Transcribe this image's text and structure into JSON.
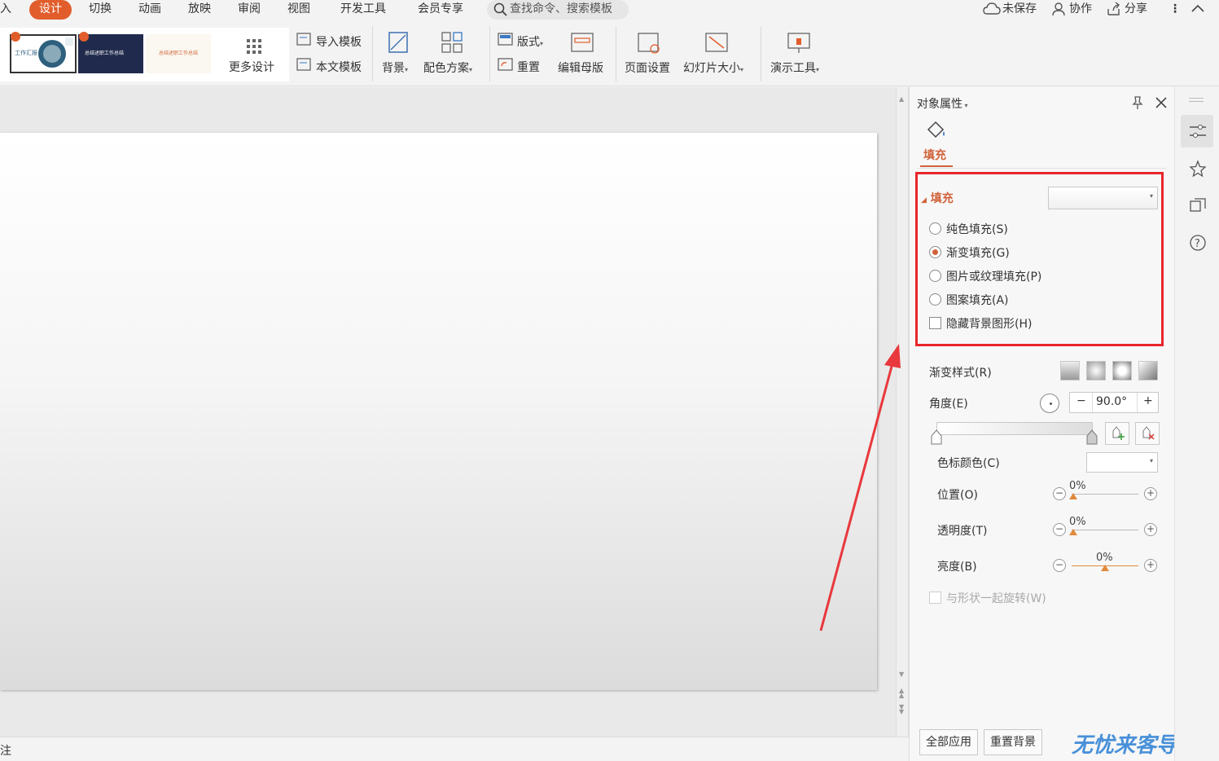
{
  "menu": {
    "partial_first": "入",
    "items": [
      "设计",
      "切换",
      "动画",
      "放映",
      "审阅",
      "视图",
      "开发工具",
      "会员专享"
    ],
    "search_placeholder": "查找命令、搜索模板",
    "right": {
      "unsaved": "未保存",
      "collab": "协作",
      "share": "分享"
    }
  },
  "ribbon": {
    "more_design": "更多设计",
    "import_template": "导入模板",
    "this_template": "本文模板",
    "background": "背景",
    "color_scheme": "配色方案",
    "layout": "版式",
    "reset": "重置",
    "edit_master": "编辑母版",
    "page_setup": "页面设置",
    "slide_size": "幻灯片大小",
    "present_tools": "演示工具",
    "thumbs": [
      "工作汇报",
      "总结述职工作总结",
      "总结述职工作总结"
    ]
  },
  "pane": {
    "title": "对象属性",
    "tab_fill": "填充",
    "section_fill": "填充",
    "options": [
      {
        "label": "纯色填充(S)",
        "checked": false
      },
      {
        "label": "渐变填充(G)",
        "checked": true
      },
      {
        "label": "图片或纹理填充(P)",
        "checked": false
      },
      {
        "label": "图案填充(A)",
        "checked": false
      }
    ],
    "hide_bg": "隐藏背景图形(H)",
    "gradient_style": "渐变样式(R)",
    "angle_label": "角度(E)",
    "angle_value": "90.0°",
    "stop_color": "色标颜色(C)",
    "position_label": "位置(O)",
    "position_value": "0%",
    "transparency_label": "透明度(T)",
    "transparency_value": "0%",
    "brightness_label": "亮度(B)",
    "brightness_value": "0%",
    "rotate_with_shape": "与形状一起旋转(W)",
    "apply_all": "全部应用",
    "reset_bg": "重置背景"
  },
  "status": {
    "partial": "注"
  },
  "watermark": "无忧来客导航",
  "colors": {
    "accent": "#e15d2b",
    "highlight_box": "#e8262b",
    "arrow": "#e8383d"
  }
}
